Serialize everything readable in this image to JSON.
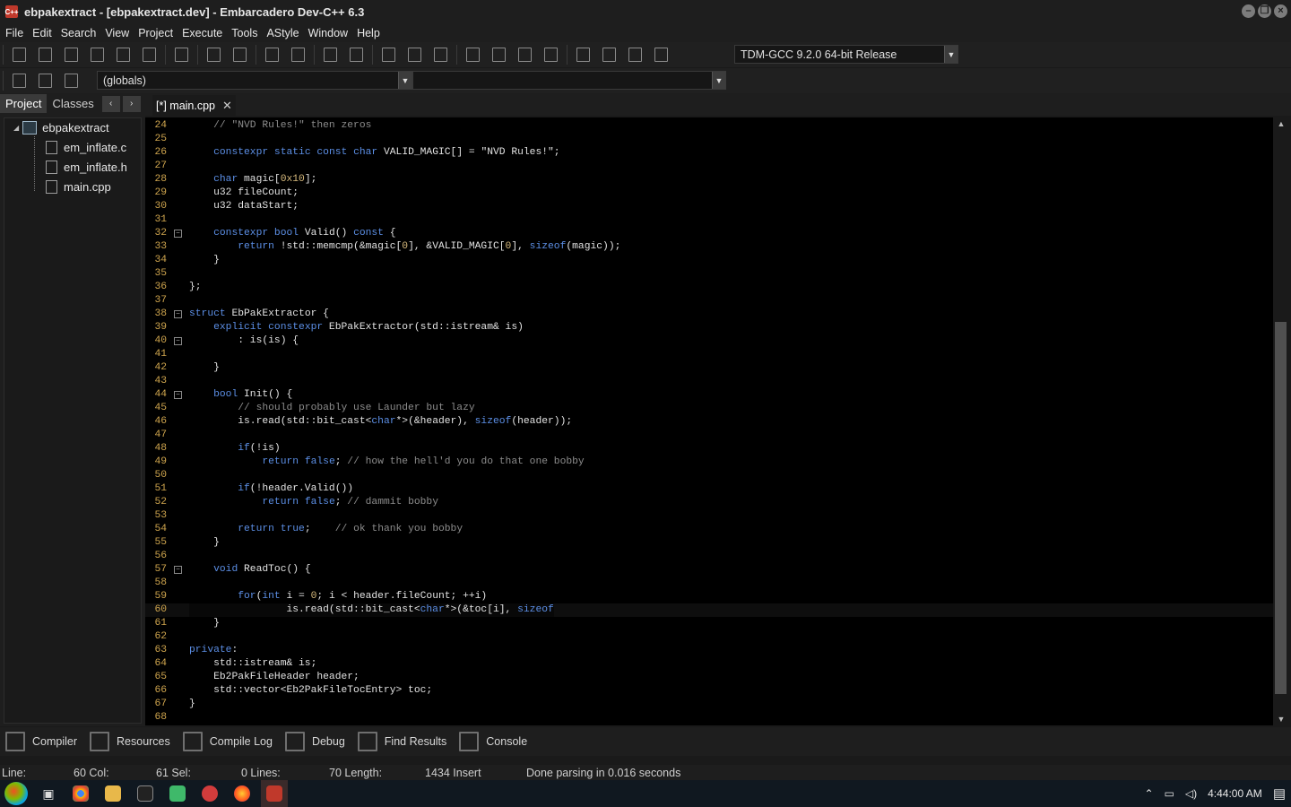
{
  "window": {
    "title": "ebpakextract - [ebpakextract.dev] - Embarcadero Dev-C++ 6.3",
    "app_icon": "C++"
  },
  "menu": [
    "File",
    "Edit",
    "Search",
    "View",
    "Project",
    "Execute",
    "Tools",
    "AStyle",
    "Window",
    "Help"
  ],
  "toolbar": {
    "compiler": "TDM-GCC 9.2.0 64-bit Release",
    "scope": "(globals)",
    "member": ""
  },
  "left_panel": {
    "tabs": [
      "Project",
      "Classes"
    ],
    "nav": [
      "‹",
      "›"
    ],
    "tree": {
      "root": "ebpakextract",
      "files": [
        "em_inflate.c",
        "em_inflate.h",
        "main.cpp"
      ]
    }
  },
  "editor": {
    "tab_label": "[*] main.cpp",
    "tab_close": "✕",
    "lines": [
      {
        "n": "24",
        "t": "    // \"NVD Rules!\" then zeros"
      },
      {
        "n": "25",
        "t": ""
      },
      {
        "n": "26",
        "t": "    constexpr static const char VALID_MAGIC[] = \"NVD Rules!\";"
      },
      {
        "n": "27",
        "t": ""
      },
      {
        "n": "28",
        "t": "    char magic[0x10];"
      },
      {
        "n": "29",
        "t": "    u32 fileCount;"
      },
      {
        "n": "30",
        "t": "    u32 dataStart;"
      },
      {
        "n": "31",
        "t": ""
      },
      {
        "n": "32",
        "t": "    constexpr bool Valid() const {",
        "fold": "−"
      },
      {
        "n": "33",
        "t": "        return !std::memcmp(&magic[0], &VALID_MAGIC[0], sizeof(magic));"
      },
      {
        "n": "34",
        "t": "    }"
      },
      {
        "n": "35",
        "t": ""
      },
      {
        "n": "36",
        "t": "};"
      },
      {
        "n": "37",
        "t": ""
      },
      {
        "n": "38",
        "t": "struct EbPakExtractor {",
        "fold": "−"
      },
      {
        "n": "39",
        "t": "    explicit constexpr EbPakExtractor(std::istream& is)"
      },
      {
        "n": "40",
        "t": "        : is(is) {",
        "fold": "−"
      },
      {
        "n": "41",
        "t": ""
      },
      {
        "n": "42",
        "t": "    }"
      },
      {
        "n": "43",
        "t": ""
      },
      {
        "n": "44",
        "t": "    bool Init() {",
        "fold": "−"
      },
      {
        "n": "45",
        "t": "        // should probably use Launder but lazy"
      },
      {
        "n": "46",
        "t": "        is.read(std::bit_cast<char*>(&header), sizeof(header));"
      },
      {
        "n": "47",
        "t": ""
      },
      {
        "n": "48",
        "t": "        if(!is)"
      },
      {
        "n": "49",
        "t": "            return false; // how the hell'd you do that one bobby"
      },
      {
        "n": "50",
        "t": ""
      },
      {
        "n": "51",
        "t": "        if(!header.Valid())"
      },
      {
        "n": "52",
        "t": "            return false; // dammit bobby"
      },
      {
        "n": "53",
        "t": ""
      },
      {
        "n": "54",
        "t": "        return true;    // ok thank you bobby"
      },
      {
        "n": "55",
        "t": "    }"
      },
      {
        "n": "56",
        "t": ""
      },
      {
        "n": "57",
        "t": "    void ReadToc() {",
        "fold": "−"
      },
      {
        "n": "58",
        "t": ""
      },
      {
        "n": "59",
        "t": "        for(int i = 0; i < header.fileCount; ++i)"
      },
      {
        "n": "60",
        "t": "                is.read(std::bit_cast<char*>(&toc[i], sizeof",
        "current": true
      },
      {
        "n": "61",
        "t": "    }"
      },
      {
        "n": "62",
        "t": ""
      },
      {
        "n": "63",
        "t": "private:"
      },
      {
        "n": "64",
        "t": "    std::istream& is;"
      },
      {
        "n": "65",
        "t": "    Eb2PakFileHeader header;"
      },
      {
        "n": "66",
        "t": "    std::vector<Eb2PakFileTocEntry> toc;"
      },
      {
        "n": "67",
        "t": "}"
      },
      {
        "n": "68",
        "t": ""
      }
    ]
  },
  "bottom_tabs": [
    "Compiler",
    "Resources",
    "Compile Log",
    "Debug",
    "Find Results",
    "Console"
  ],
  "status": {
    "line_label": "Line:",
    "line_val": "60 Col:",
    "col_val": "61 Sel:",
    "sel_val": "0 Lines:",
    "lines_val": "70 Length:",
    "length_val": "1434 Insert",
    "message": "Done parsing in 0.016 seconds"
  },
  "taskbar": {
    "clock": "4:44:00 AM",
    "icons": [
      "chrome",
      "explorer",
      "7zip",
      "notepad",
      "app-red",
      "firefox",
      "devcpp"
    ]
  },
  "colors": {
    "keyword": "#5c8fe6",
    "comment": "#8c8c8c",
    "string": "#e2e2e2",
    "number": "#d7ba7d",
    "linenum": "#cfa54e",
    "accent": "#c0392b"
  }
}
